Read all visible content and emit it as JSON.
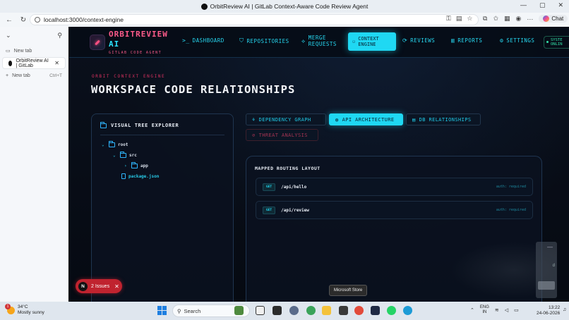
{
  "browser": {
    "window_title": "OrbitReview AI | GitLab Context-Aware Code Review Agent",
    "url": "localhost:3000/context-engine",
    "copilot_label": "Chat",
    "tabs_panel": {
      "items": [
        {
          "label": "New tab"
        },
        {
          "label": "OrbitReview AI | GitLab"
        },
        {
          "label": "New tab",
          "shortcut": "Ctrl+T"
        }
      ]
    }
  },
  "app": {
    "brand": {
      "name_main": "ORBITREVIEW",
      "name_ai": "AI",
      "tagline": "GITLAB CODE AGENT"
    },
    "nav": [
      {
        "label": "DASHBOARD",
        "icon": "terminal-icon"
      },
      {
        "label": "REPOSITORIES",
        "icon": "shield-icon"
      },
      {
        "label_l1": "MERGE",
        "label_l2": "REQUESTS",
        "icon": "merge-icon"
      },
      {
        "label_l1": "CONTEXT",
        "label_l2": "ENGINE",
        "icon": "network-icon",
        "active": true
      },
      {
        "label": "REVIEWS",
        "icon": "refresh-icon"
      },
      {
        "label": "REPORTS",
        "icon": "bar-chart-icon"
      },
      {
        "label": "SETTINGS",
        "icon": "gear-icon"
      }
    ],
    "system_badge": {
      "l1": "SYSTE",
      "l2": "ONLIN"
    },
    "page": {
      "eyebrow": "ORBIT CONTEXT ENGINE",
      "title": "WORKSPACE CODE RELATIONSHIPS"
    },
    "tree": {
      "heading": "VISUAL TREE EXPLORER",
      "nodes": [
        {
          "label": "root",
          "type": "folder",
          "expanded": true
        },
        {
          "label": "src",
          "type": "folder",
          "expanded": true
        },
        {
          "label": "app",
          "type": "folder",
          "expanded": false
        },
        {
          "label": "package.json",
          "type": "file"
        }
      ]
    },
    "tabs": [
      {
        "label": "DEPENDENCY GRAPH",
        "icon": "graph-icon"
      },
      {
        "label": "API ARCHITECTURE",
        "icon": "globe-icon",
        "active": true
      },
      {
        "label": "DB RELATIONSHIPS",
        "icon": "database-icon"
      },
      {
        "label": "THREAT ANALYSIS",
        "icon": "alert-icon"
      }
    ],
    "routes": {
      "heading": "MAPPED ROUTING LAYOUT",
      "items": [
        {
          "method": "GET",
          "path": "/api/hello",
          "auth": "auth: required"
        },
        {
          "method": "GET",
          "path": "/api/review",
          "auth": "auth: required"
        }
      ]
    },
    "issues": {
      "count": "N",
      "label": "2 Issues"
    },
    "overlay_card": {
      "letter": "d"
    }
  },
  "tooltip": "Microsoft Store",
  "taskbar": {
    "weather": {
      "temp": "34°C",
      "desc": "Mostly sunny",
      "badge": "1"
    },
    "search_placeholder": "Search",
    "lang": {
      "l1": "ENG",
      "l2": "IN"
    },
    "time": "13:22",
    "date": "24-06-2026"
  },
  "colors": {
    "accent": "#1fd8f3",
    "brand_pink": "#ff5b8a",
    "background": "#070b14",
    "danger": "#c0232f"
  }
}
